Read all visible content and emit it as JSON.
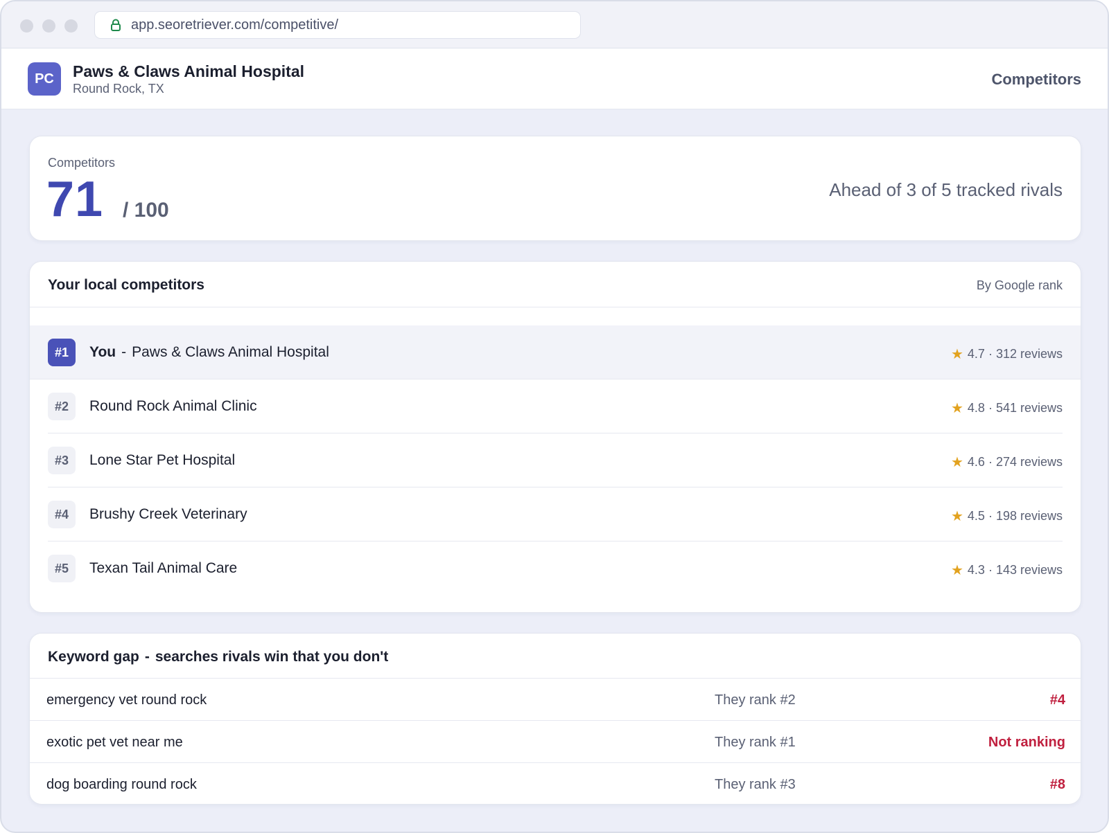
{
  "browser": {
    "url": "app.seoretriever.com/competitive/"
  },
  "header": {
    "logo_initials": "PC",
    "business_name": "Paws & Claws Animal Hospital",
    "location": "Round Rock, TX",
    "nav_label": "Competitors"
  },
  "score": {
    "label": "Competitors",
    "value": "71",
    "max": "/ 100",
    "summary": "Ahead of 3 of 5 tracked rivals"
  },
  "competitors": {
    "title": "Your local competitors",
    "sort_label": "By Google rank",
    "you_label": "You",
    "separator": "-",
    "rows": [
      {
        "rank": "#1",
        "name": "Paws & Claws Animal Hospital",
        "meta": "4.7 · 312 reviews",
        "is_you": true
      },
      {
        "rank": "#2",
        "name": "Round Rock Animal Clinic",
        "meta": "4.8 · 541 reviews"
      },
      {
        "rank": "#3",
        "name": "Lone Star Pet Hospital",
        "meta": "4.6 · 274 reviews"
      },
      {
        "rank": "#4",
        "name": "Brushy Creek Veterinary",
        "meta": "4.5 · 198 reviews"
      },
      {
        "rank": "#5",
        "name": "Texan Tail Animal Care",
        "meta": "4.3 · 143 reviews"
      }
    ]
  },
  "keyword_gap": {
    "title": "Keyword gap",
    "separator": "-",
    "subtitle": "searches rivals win that you don't",
    "rows": [
      {
        "keyword": "emergency vet round rock",
        "they": "They rank #2",
        "you": "#4"
      },
      {
        "keyword": "exotic pet vet near me",
        "they": "They rank #1",
        "you": "Not ranking"
      },
      {
        "keyword": "dog boarding round rock",
        "they": "They rank #3",
        "you": "#8"
      }
    ]
  },
  "colors": {
    "accent": "#4a52b8",
    "star": "#e2a21f",
    "danger": "#c0203f"
  }
}
